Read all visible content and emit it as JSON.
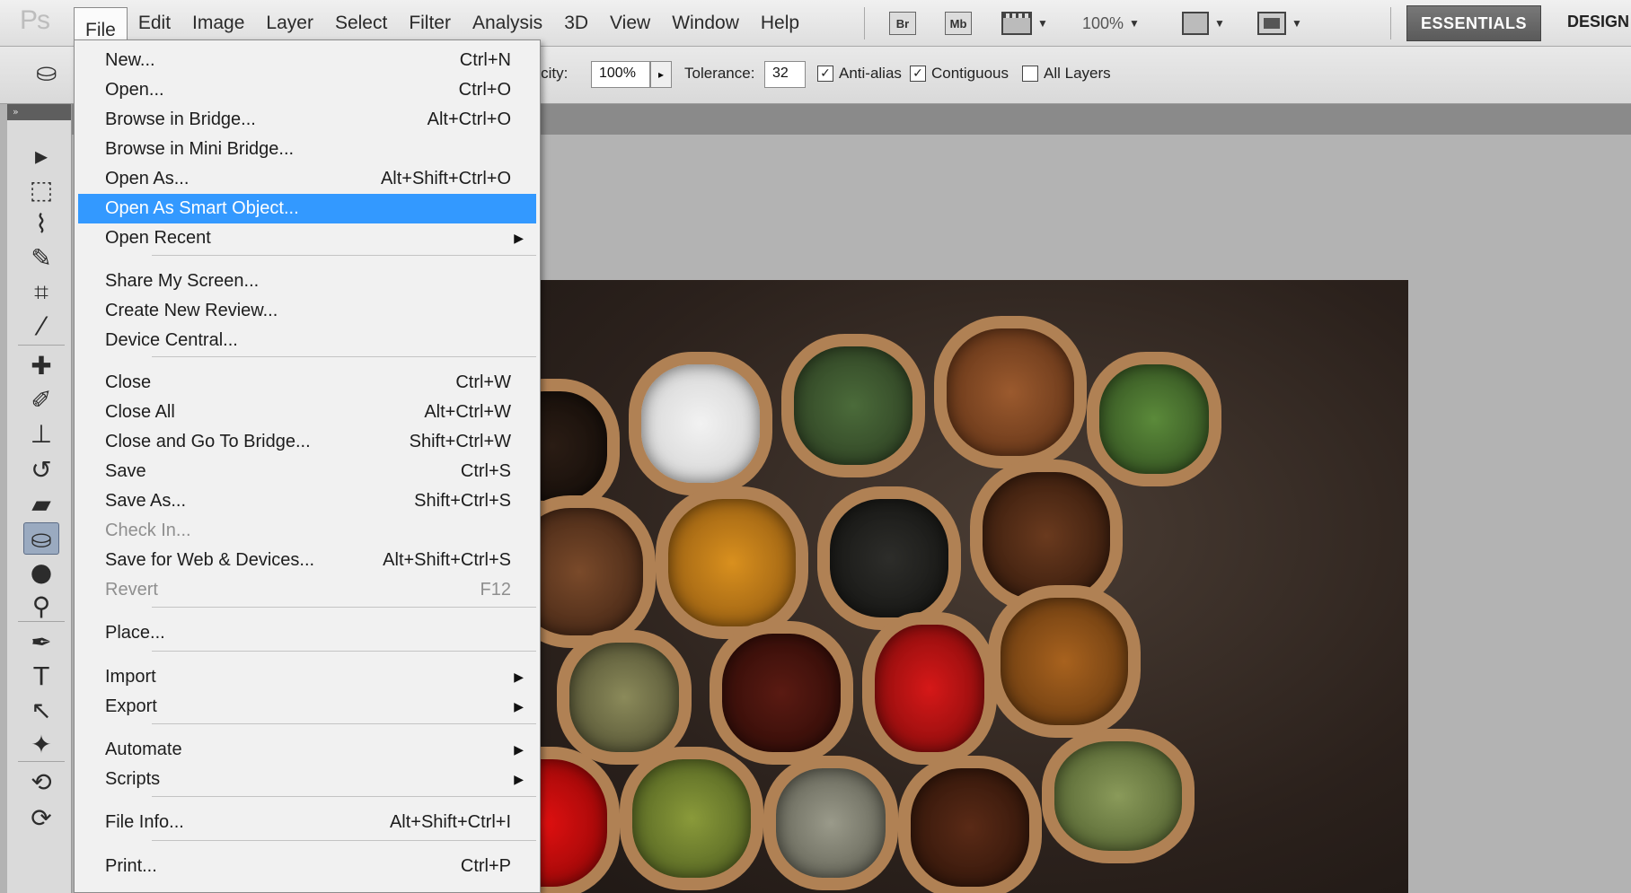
{
  "app": {
    "logo": "Ps",
    "menus": [
      {
        "label": "File",
        "active": true
      },
      {
        "label": "Edit"
      },
      {
        "label": "Image"
      },
      {
        "label": "Layer"
      },
      {
        "label": "Select"
      },
      {
        "label": "Filter"
      },
      {
        "label": "Analysis"
      },
      {
        "label": "3D"
      },
      {
        "label": "View"
      },
      {
        "label": "Window"
      },
      {
        "label": "Help"
      }
    ],
    "bridge_button": "Br",
    "mini_bridge_button": "Mb",
    "zoom": "100%",
    "workspace_active": "ESSENTIALS",
    "workspace_next": "DESIGN"
  },
  "options": {
    "opacity_label": "Opacity:",
    "opacity_value": "100%",
    "tolerance_label": "Tolerance:",
    "tolerance_value": "32",
    "anti_alias_label": "Anti-alias",
    "anti_alias_checked": true,
    "contiguous_label": "Contiguous",
    "contiguous_checked": true,
    "all_layers_label": "All Layers",
    "all_layers_checked": false
  },
  "tools": [
    {
      "icon": "move-tool-icon",
      "glyph": "▸"
    },
    {
      "icon": "marquee-tool-icon",
      "glyph": "⬚"
    },
    {
      "icon": "lasso-tool-icon",
      "glyph": "⌇"
    },
    {
      "icon": "quick-selection-tool-icon",
      "glyph": "✎"
    },
    {
      "icon": "crop-tool-icon",
      "glyph": "⌗"
    },
    {
      "icon": "eyedropper-tool-icon",
      "glyph": "⁄"
    },
    {
      "icon": "healing-brush-tool-icon",
      "glyph": "✚"
    },
    {
      "icon": "brush-tool-icon",
      "glyph": "✐"
    },
    {
      "icon": "stamp-tool-icon",
      "glyph": "⊥"
    },
    {
      "icon": "history-brush-tool-icon",
      "glyph": "↺"
    },
    {
      "icon": "eraser-tool-icon",
      "glyph": "▰"
    },
    {
      "icon": "paint-bucket-tool-icon",
      "glyph": "⛀",
      "selected": true
    },
    {
      "icon": "blur-tool-icon",
      "glyph": "●"
    },
    {
      "icon": "dodge-tool-icon",
      "glyph": "⚲"
    },
    {
      "icon": "pen-tool-icon",
      "glyph": "✒"
    },
    {
      "icon": "type-tool-icon",
      "glyph": "T"
    },
    {
      "icon": "path-selection-tool-icon",
      "glyph": "↖"
    },
    {
      "icon": "shape-tool-icon",
      "glyph": "✦"
    },
    {
      "icon": "3d-rotate-tool-icon",
      "glyph": "⟲"
    },
    {
      "icon": "3d-orbit-tool-icon",
      "glyph": "⟳"
    }
  ],
  "file_menu": {
    "items": [
      {
        "label": "New...",
        "shortcut": "Ctrl+N"
      },
      {
        "label": "Open...",
        "shortcut": "Ctrl+O"
      },
      {
        "label": "Browse in Bridge...",
        "shortcut": "Alt+Ctrl+O"
      },
      {
        "label": "Browse in Mini Bridge...",
        "shortcut": ""
      },
      {
        "label": "Open As...",
        "shortcut": "Alt+Shift+Ctrl+O"
      },
      {
        "label": "Open As Smart Object...",
        "shortcut": "",
        "highlighted": true
      },
      {
        "label": "Open Recent",
        "shortcut": "",
        "submenu": true
      },
      {
        "label": "Share My Screen...",
        "shortcut": ""
      },
      {
        "label": "Create New Review...",
        "shortcut": ""
      },
      {
        "label": "Device Central...",
        "shortcut": ""
      },
      {
        "label": "Close",
        "shortcut": "Ctrl+W"
      },
      {
        "label": "Close All",
        "shortcut": "Alt+Ctrl+W"
      },
      {
        "label": "Close and Go To Bridge...",
        "shortcut": "Shift+Ctrl+W"
      },
      {
        "label": "Save",
        "shortcut": "Ctrl+S"
      },
      {
        "label": "Save As...",
        "shortcut": "Shift+Ctrl+S"
      },
      {
        "label": "Check In...",
        "shortcut": "",
        "disabled": true
      },
      {
        "label": "Save for Web & Devices...",
        "shortcut": "Alt+Shift+Ctrl+S"
      },
      {
        "label": "Revert",
        "shortcut": "F12",
        "disabled": true
      },
      {
        "label": "Place...",
        "shortcut": ""
      },
      {
        "label": "Import",
        "shortcut": "",
        "submenu": true
      },
      {
        "label": "Export",
        "shortcut": "",
        "submenu": true
      },
      {
        "label": "Automate",
        "shortcut": "",
        "submenu": true
      },
      {
        "label": "Scripts",
        "shortcut": "",
        "submenu": true
      },
      {
        "label": "File Info...",
        "shortcut": "Alt+Shift+Ctrl+I"
      },
      {
        "label": "Print...",
        "shortcut": "Ctrl+P"
      }
    ]
  },
  "document": {
    "image_subject": "photo of spice sacks"
  }
}
